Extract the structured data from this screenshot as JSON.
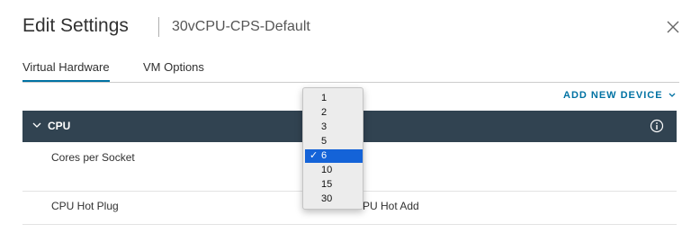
{
  "dialog": {
    "title": "Edit Settings",
    "subtitle": "30vCPU-CPS-Default"
  },
  "tabs": [
    {
      "label": "Virtual Hardware"
    },
    {
      "label": "VM Options"
    }
  ],
  "toolbar": {
    "add_device_label": "ADD NEW DEVICE"
  },
  "cpu": {
    "section_label": "CPU",
    "rows": [
      {
        "label": "Cores per Socket"
      },
      {
        "label": "CPU Hot Plug",
        "value": "PU Hot Add"
      }
    ]
  },
  "dropdown": {
    "options": [
      "1",
      "2",
      "3",
      "5",
      "6",
      "10",
      "15",
      "30"
    ],
    "selected": "6",
    "check_mark": "✓"
  },
  "colors": {
    "accent": "#0072a3",
    "header_bg": "#314351",
    "selection": "#1463d8"
  },
  "icons": {
    "close": "close-icon",
    "expand": "chevron-down-icon",
    "info": "info-icon"
  }
}
